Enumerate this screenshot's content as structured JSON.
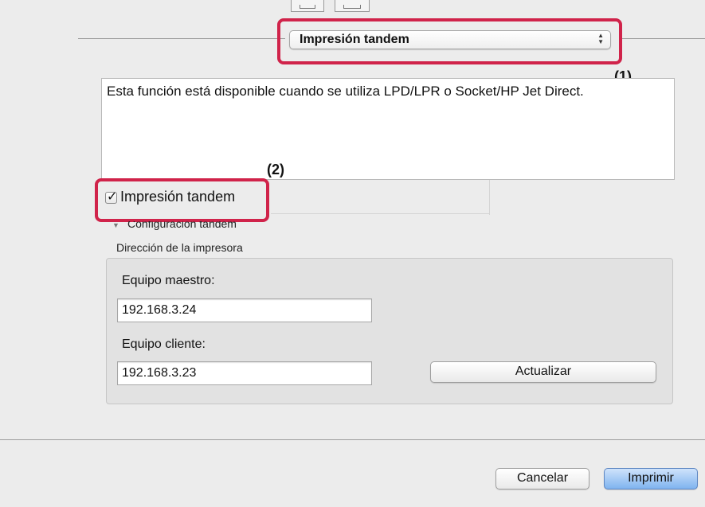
{
  "print_mode_popup": {
    "selected": "Impresión tandem",
    "callout_number": "(1)"
  },
  "description": "Esta función está disponible cuando se utiliza LPD/LPR o Socket/HP Jet Direct.",
  "tandem_checkbox": {
    "label": "Impresión tandem",
    "checked": true,
    "callout_number": "(2)"
  },
  "tandem_settings": {
    "disclosure_label": "Configuración tandem",
    "group_title": "Dirección de la impresora",
    "master_label": "Equipo maestro:",
    "master_value": "192.168.3.24",
    "client_label": "Equipo cliente:",
    "client_value": "192.168.3.23",
    "update_label": "Actualizar"
  },
  "footer": {
    "cancel_label": "Cancelar",
    "print_label": "Imprimir"
  },
  "colors": {
    "callout": "#d0234a",
    "primary_button": "#7fb3ef"
  }
}
